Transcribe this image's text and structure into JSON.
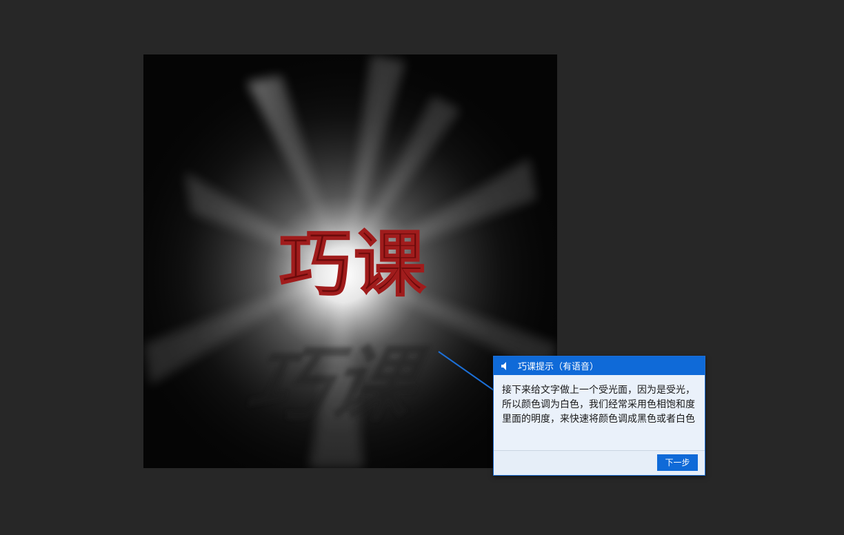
{
  "canvas": {
    "artwork_text": "巧课",
    "artwork_text_color": "#6b0a0a",
    "background_color": "#050505"
  },
  "tip": {
    "title": "巧课提示（有语音）",
    "speaker_icon": "speaker-icon",
    "body": "接下来给文字做上一个受光面，因为是受光，所以颜色调为白色，我们经常采用色相饱和度里面的明度，来快速将颜色调成黑色或者白色",
    "next_label": "下一步",
    "accent_color": "#0f6ad8"
  }
}
